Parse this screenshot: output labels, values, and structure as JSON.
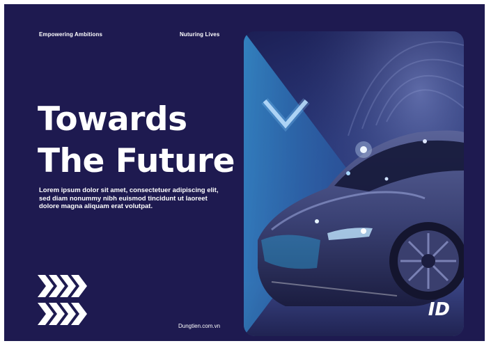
{
  "poster": {
    "tagline_left": "Empowering Ambitions",
    "tagline_right": "Nuturing Lives",
    "headline_line1": "Towards",
    "headline_line2": "The Future",
    "body": "Lorem ipsum dolor sit amet, consectetuer adipiscing elit, sed diam nonummy nibh euismod tincidunt ut laoreet dolore magna aliquam erat volutpat.",
    "website": "Dungtien.com.vn"
  },
  "icons": {
    "decoration": "chevron-arrows-icon",
    "logo": "brand-logo-icon"
  },
  "colors": {
    "background": "#1e1a50",
    "text": "#ffffff",
    "accent": "#3aa0e0"
  }
}
